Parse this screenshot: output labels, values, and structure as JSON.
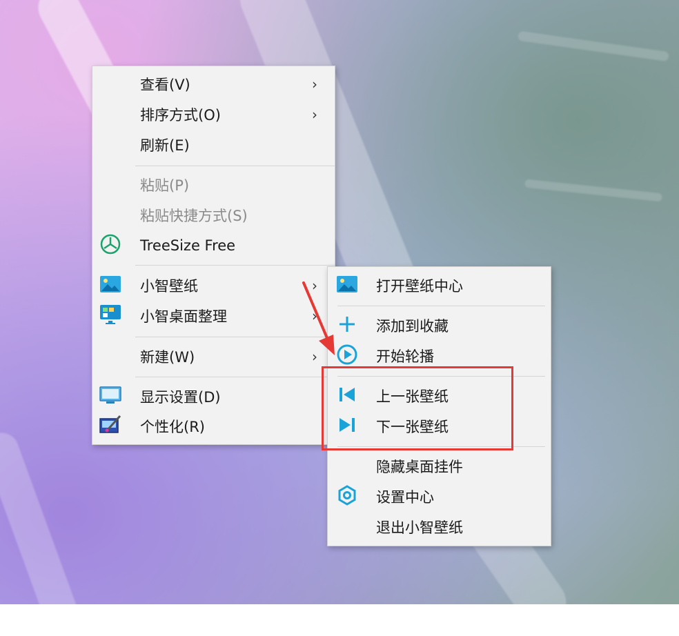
{
  "desktop_menu": {
    "items": [
      {
        "label": "查看(V)",
        "submenu": true
      },
      {
        "label": "排序方式(O)",
        "submenu": true
      },
      {
        "label": "刷新(E)"
      },
      {
        "label": "粘贴(P)",
        "disabled": true
      },
      {
        "label": "粘贴快捷方式(S)",
        "disabled": true
      },
      {
        "label": "TreeSize Free",
        "icon": "treesize-icon"
      },
      {
        "label": "小智壁纸",
        "icon": "wallpaper-picture-icon",
        "submenu": true
      },
      {
        "label": "小智桌面整理",
        "icon": "desktop-organize-icon",
        "submenu": true
      },
      {
        "label": "新建(W)",
        "submenu": true
      },
      {
        "label": "显示设置(D)",
        "icon": "display-icon"
      },
      {
        "label": "个性化(R)",
        "icon": "personalize-icon"
      }
    ]
  },
  "wallpaper_submenu": {
    "items": [
      {
        "label": "打开壁纸中心",
        "icon": "picture-icon"
      },
      {
        "label": "添加到收藏",
        "icon": "plus-icon"
      },
      {
        "label": "开始轮播",
        "icon": "play-circle-icon"
      },
      {
        "label": "上一张壁纸",
        "icon": "previous-icon"
      },
      {
        "label": "下一张壁纸",
        "icon": "next-icon"
      },
      {
        "label": "隐藏桌面挂件"
      },
      {
        "label": "设置中心",
        "icon": "settings-icon"
      },
      {
        "label": "退出小智壁纸"
      }
    ]
  },
  "colors": {
    "accent": "#1aa3d9",
    "highlight_box": "#e53935",
    "arrow": "#e53935",
    "treesize_green": "#1aa36b"
  }
}
